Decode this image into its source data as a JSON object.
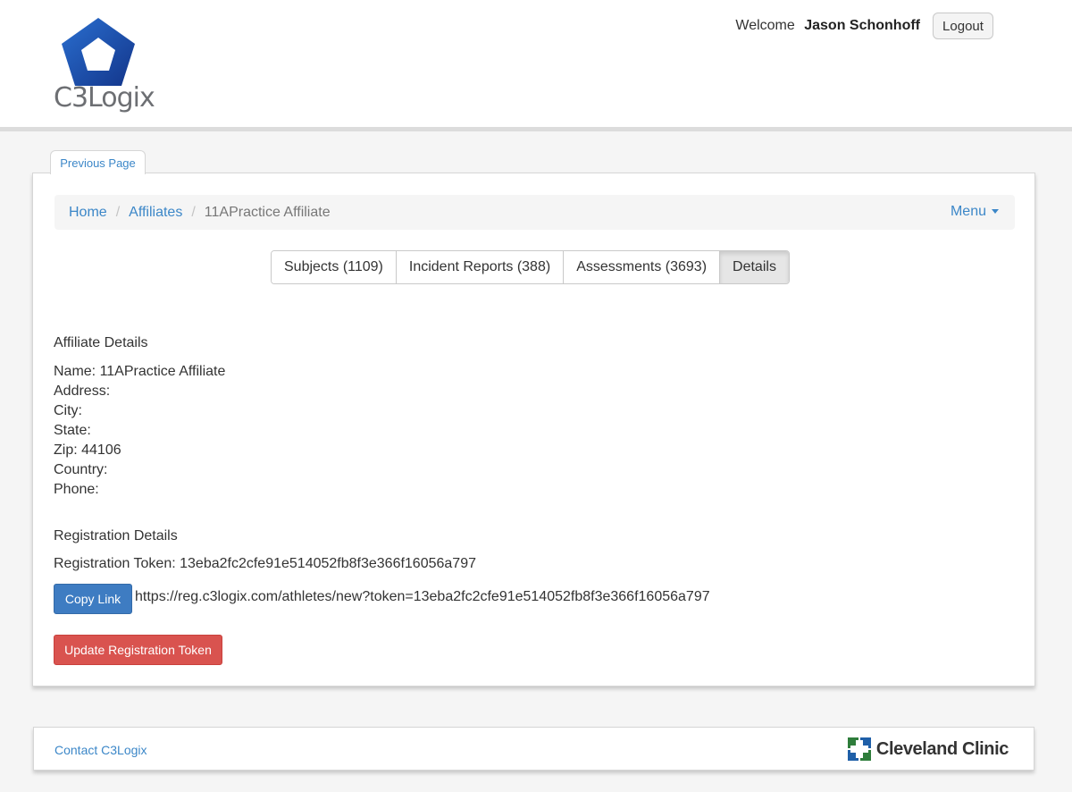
{
  "header": {
    "logo_text": "C3Logix",
    "welcome": "Welcome",
    "user_name": "Jason Schonhoff",
    "logout_label": "Logout"
  },
  "prev_tab_label": "Previous Page",
  "breadcrumb": {
    "items": [
      "Home",
      "Affiliates",
      "11APractice Affiliate"
    ],
    "menu_label": "Menu"
  },
  "tabs": [
    {
      "label": "Subjects (1109)"
    },
    {
      "label": "Incident Reports (388)"
    },
    {
      "label": "Assessments (3693)"
    },
    {
      "label": "Details",
      "active": true
    }
  ],
  "affiliate": {
    "title": "Affiliate Details",
    "name": "Name: 11APractice Affiliate",
    "address": "Address:",
    "city": "City:",
    "state": "State:",
    "zip": "Zip: 44106",
    "country": "Country:",
    "phone": "Phone:"
  },
  "registration": {
    "title": "Registration Details",
    "token_line": "Registration Token: 13eba2fc2cfe91e514052fb8f3e366f16056a797",
    "copy_label": "Copy Link",
    "url": "https://reg.c3logix.com/athletes/new?token=13eba2fc2cfe91e514052fb8f3e366f16056a797",
    "update_label": "Update Registration Token"
  },
  "footer": {
    "contact": "Contact C3Logix",
    "partner": "Cleveland Clinic"
  },
  "colors": {
    "link": "#3c87c8",
    "primary": "#3e7cc2",
    "danger": "#d9534f",
    "logo_blue": "#1f4fa8"
  }
}
